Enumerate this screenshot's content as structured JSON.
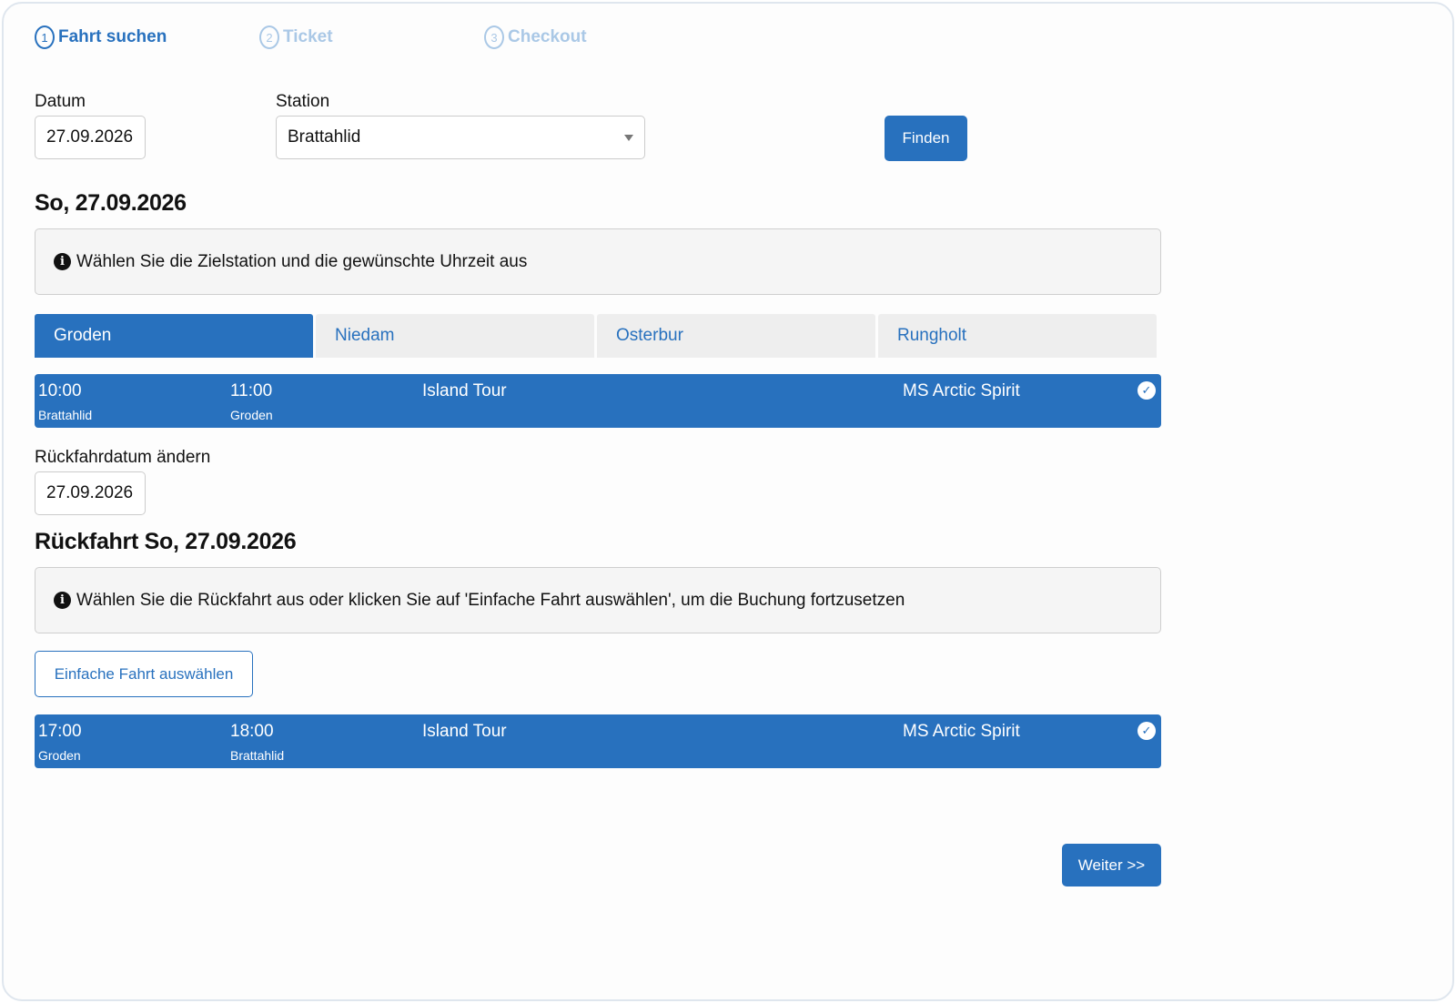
{
  "stepper": {
    "steps": [
      {
        "num": "1",
        "label": "Fahrt suchen",
        "state": "active"
      },
      {
        "num": "2",
        "label": "Ticket",
        "state": "inactive"
      },
      {
        "num": "3",
        "label": "Checkout",
        "state": "inactive"
      }
    ]
  },
  "search": {
    "date_label": "Datum",
    "date_value": "27.09.2026",
    "station_label": "Station",
    "station_value": "Brattahlid",
    "find_button": "Finden"
  },
  "outbound": {
    "heading": "So, 27.09.2026",
    "info": "Wählen Sie die Zielstation und die gewünschte Uhrzeit aus",
    "tabs": [
      {
        "label": "Groden",
        "active": true
      },
      {
        "label": "Niedam",
        "active": false
      },
      {
        "label": "Osterbur",
        "active": false
      },
      {
        "label": "Rungholt",
        "active": false
      }
    ],
    "trip": {
      "depart_time": "10:00",
      "depart_station": "Brattahlid",
      "arrive_time": "11:00",
      "arrive_station": "Groden",
      "tour": "Island Tour",
      "ship": "MS Arctic Spirit",
      "selected": true
    }
  },
  "return": {
    "change_label": "Rückfahrdatum ändern",
    "date_value": "27.09.2026",
    "heading": "Rückfahrt So, 27.09.2026",
    "info": "Wählen Sie die Rückfahrt aus oder klicken Sie auf 'Einfache Fahrt auswählen', um die Buchung fortzusetzen",
    "single_trip_button": "Einfache Fahrt auswählen",
    "trip": {
      "depart_time": "17:00",
      "depart_station": "Groden",
      "arrive_time": "18:00",
      "arrive_station": "Brattahlid",
      "tour": "Island Tour",
      "ship": "MS Arctic Spirit",
      "selected": true
    }
  },
  "footer": {
    "next_button": "Weiter >>"
  },
  "colors": {
    "primary": "#2871be",
    "step_inactive": "#aac8e6",
    "info_bg": "#f5f5f5",
    "tab_inactive_bg": "#eeeeee"
  }
}
